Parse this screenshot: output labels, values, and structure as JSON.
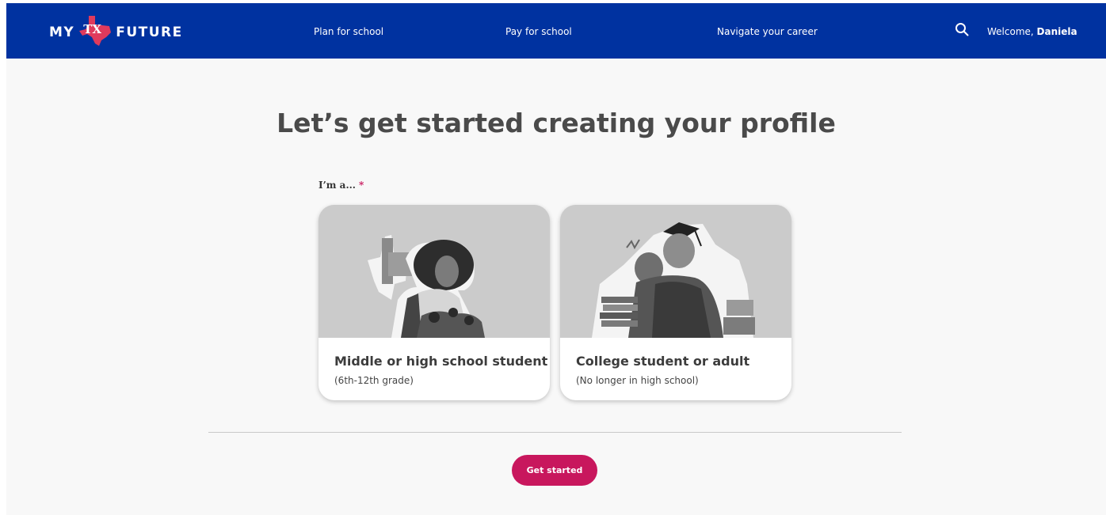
{
  "brand": {
    "logo_left": "MY",
    "logo_mark": "TX",
    "logo_right": "FUTURE",
    "colors": {
      "navbar": "#0032a0",
      "accent": "#c8175d",
      "texas_shape": "#e03a5c"
    }
  },
  "nav": {
    "items": [
      {
        "label": "Plan for school"
      },
      {
        "label": "Pay for school"
      },
      {
        "label": "Navigate your career"
      }
    ],
    "search_icon": "search-icon",
    "welcome_prefix": "Welcome,",
    "user_name": "Daniela"
  },
  "main": {
    "title": "Let’s get started creating your profile",
    "field_label": "I’m a...",
    "required_marker": "*",
    "options": [
      {
        "title": "Middle or high school student",
        "subtitle": "(6th-12th grade)"
      },
      {
        "title": "College student or adult",
        "subtitle": "(No longer in high school)"
      }
    ],
    "cta_label": "Get started"
  }
}
